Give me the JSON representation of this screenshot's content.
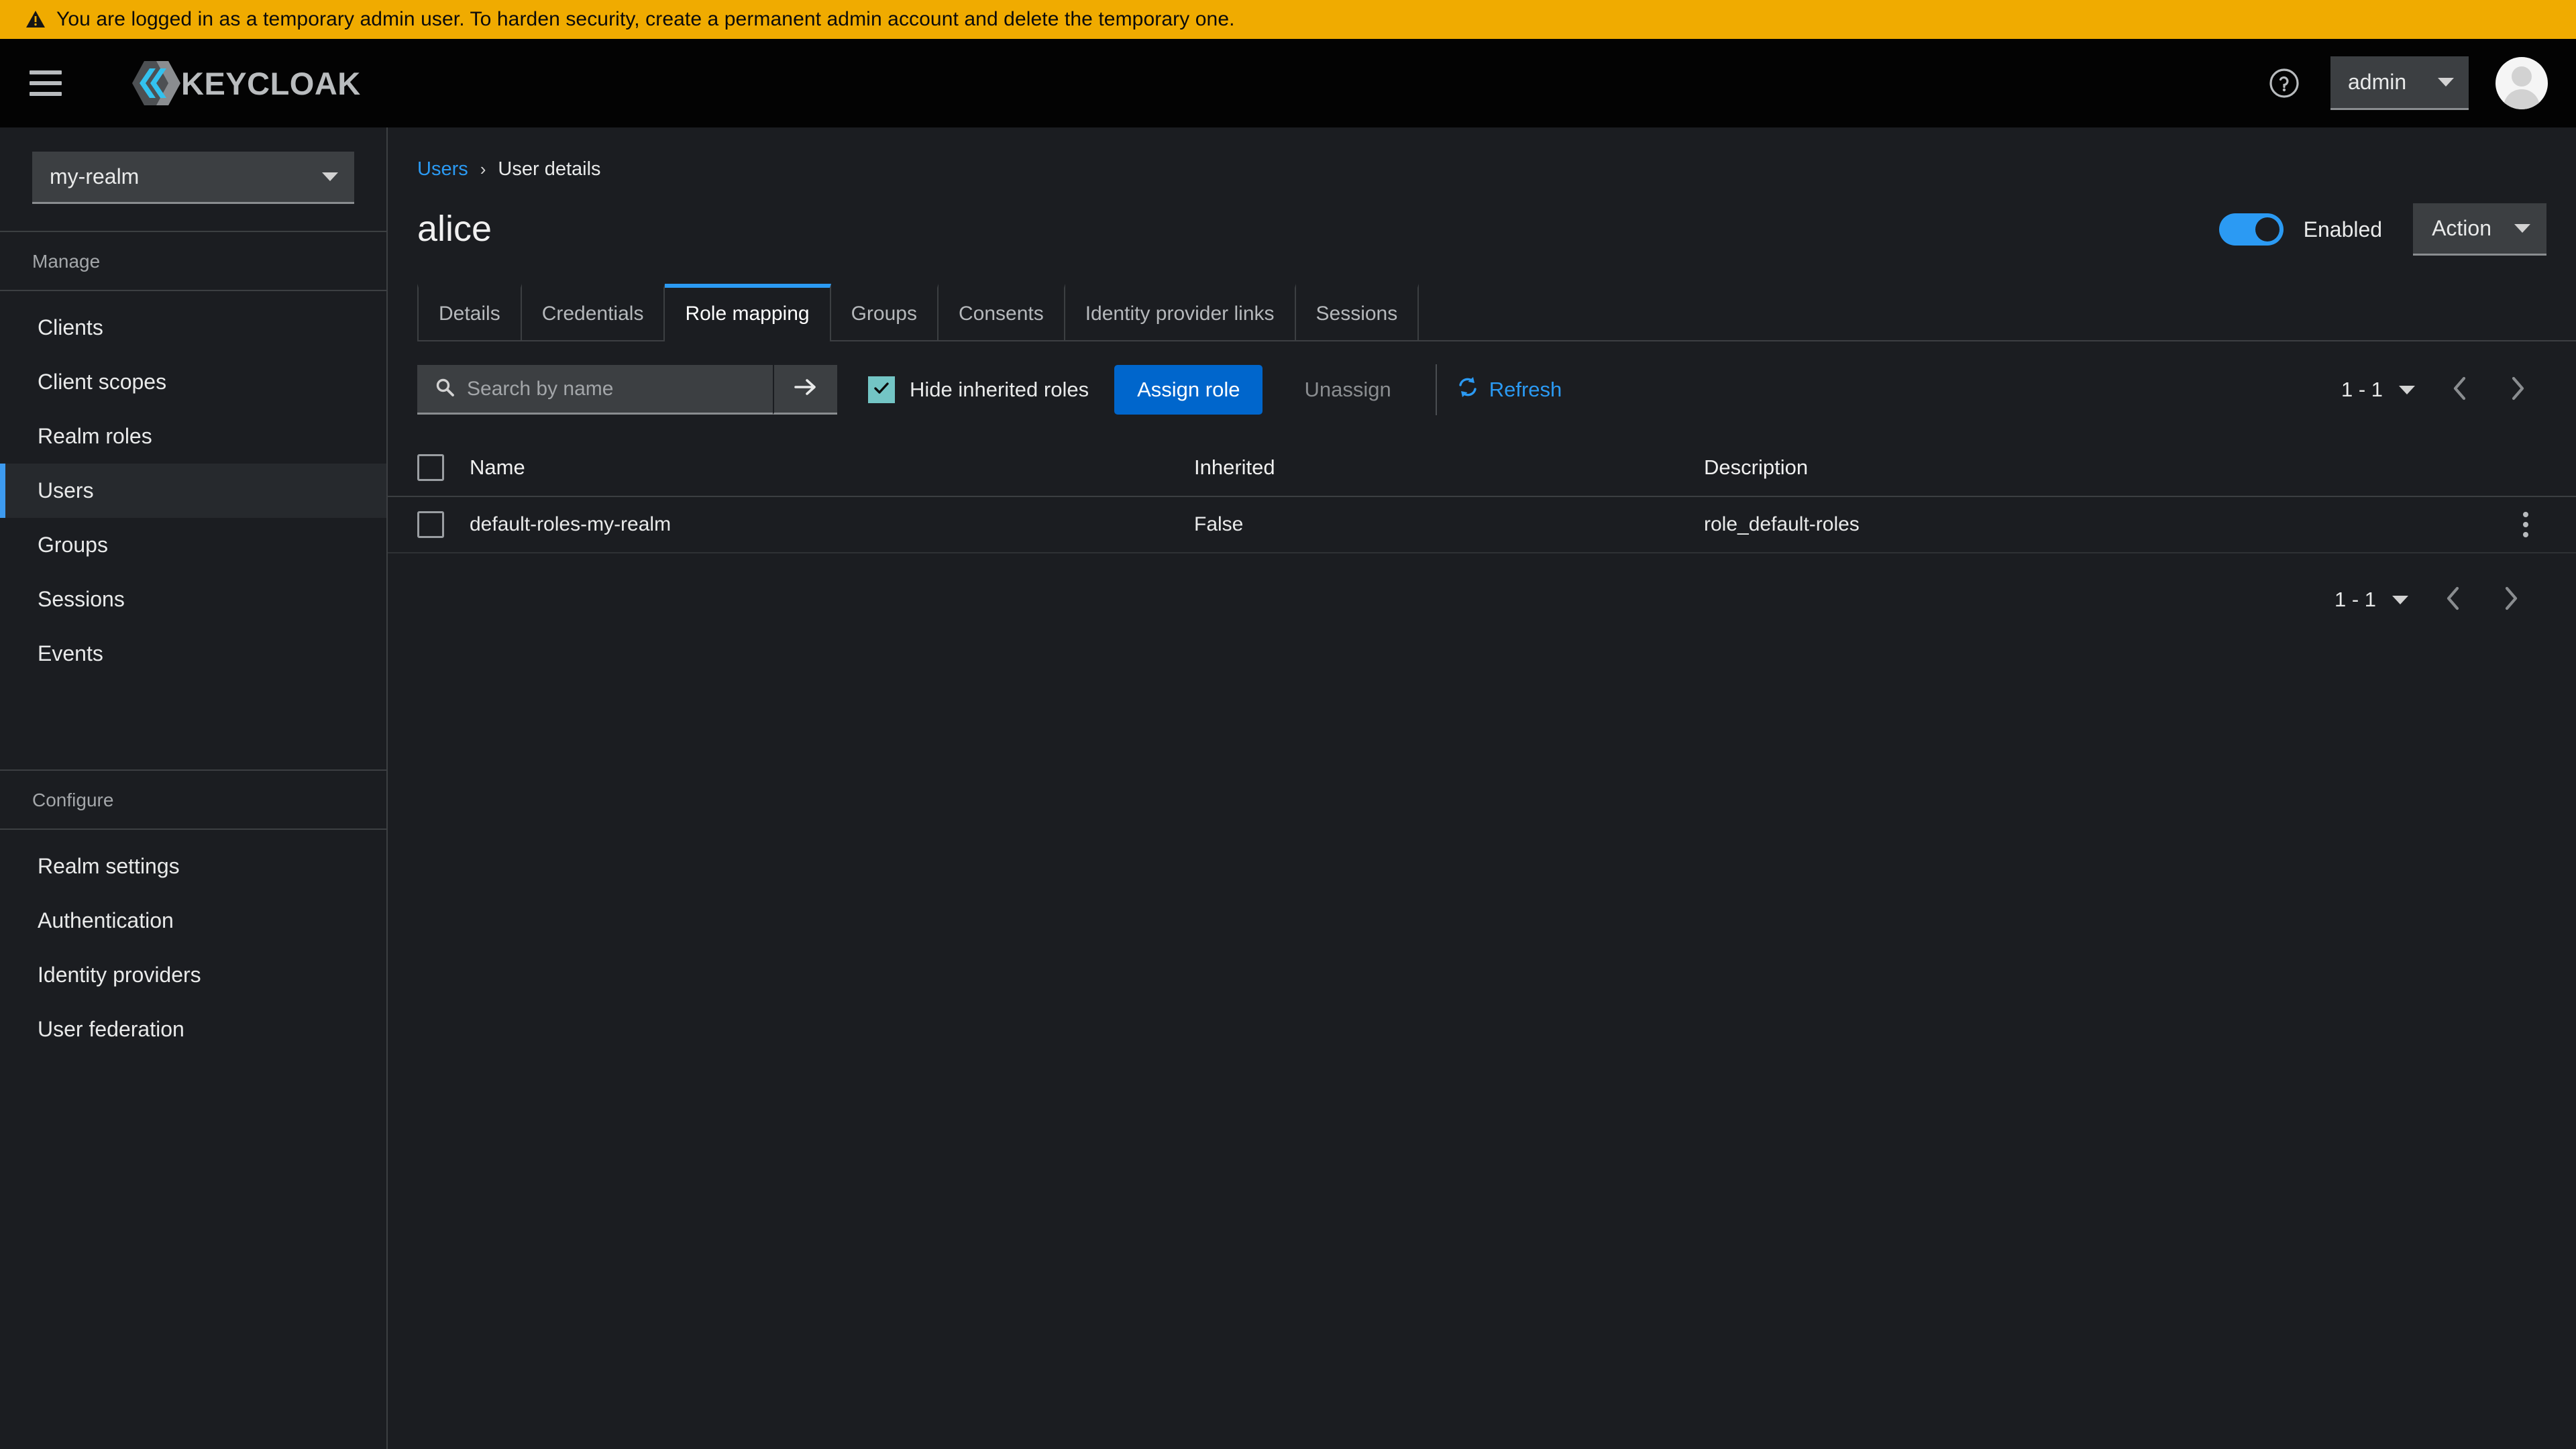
{
  "alert": {
    "icon": "warning-triangle-icon",
    "message": "You are logged in as a temporary admin user. To harden security, create a permanent admin account and delete the temporary one.",
    "background": "#f0ab00"
  },
  "masthead": {
    "menu_icon": "hamburger-icon",
    "brand_name": "KEYCLOAK",
    "help_icon": "help-circle-icon",
    "user_menu_label": "admin",
    "avatar_icon": "user-avatar-icon"
  },
  "sidebar": {
    "realm_selector": {
      "value": "my-realm",
      "caret_icon": "chevron-down-icon"
    },
    "sections": [
      {
        "title": "Manage",
        "items": [
          {
            "label": "Clients",
            "active": false
          },
          {
            "label": "Client scopes",
            "active": false
          },
          {
            "label": "Realm roles",
            "active": false
          },
          {
            "label": "Users",
            "active": true
          },
          {
            "label": "Groups",
            "active": false
          },
          {
            "label": "Sessions",
            "active": false
          },
          {
            "label": "Events",
            "active": false
          }
        ]
      },
      {
        "title": "Configure",
        "items": [
          {
            "label": "Realm settings",
            "active": false
          },
          {
            "label": "Authentication",
            "active": false
          },
          {
            "label": "Identity providers",
            "active": false
          },
          {
            "label": "User federation",
            "active": false
          }
        ]
      }
    ]
  },
  "breadcrumb": {
    "parent": "Users",
    "separator": "›",
    "current": "User details"
  },
  "page": {
    "title": "alice",
    "enabled_toggle": {
      "label": "Enabled",
      "state": "on",
      "color": "#2b9af3"
    },
    "action_menu": {
      "label": "Action",
      "caret_icon": "chevron-down-icon"
    }
  },
  "tabs": [
    {
      "label": "Details",
      "active": false
    },
    {
      "label": "Credentials",
      "active": false
    },
    {
      "label": "Role mapping",
      "active": true
    },
    {
      "label": "Groups",
      "active": false
    },
    {
      "label": "Consents",
      "active": false
    },
    {
      "label": "Identity provider links",
      "active": false
    },
    {
      "label": "Sessions",
      "active": false
    }
  ],
  "toolbar": {
    "search": {
      "icon": "search-icon",
      "placeholder": "Search by name",
      "value": "",
      "submit_icon": "arrow-right-icon"
    },
    "hide_inherited": {
      "label": "Hide inherited roles",
      "checked": true,
      "check_icon": "check-icon",
      "color": "#73c5c5"
    },
    "assign_role_label": "Assign role",
    "assign_role_color": "#0066cc",
    "unassign_label": "Unassign",
    "unassign_disabled": true,
    "refresh": {
      "label": "Refresh",
      "icon": "sync-icon",
      "color": "#2b9af3"
    }
  },
  "pagination_top": {
    "range": "1 - 1",
    "caret_icon": "chevron-down-icon",
    "prev_icon": "chevron-left-icon",
    "next_icon": "chevron-right-icon"
  },
  "pagination_bottom": {
    "range": "1 - 1",
    "caret_icon": "chevron-down-icon",
    "prev_icon": "chevron-left-icon",
    "next_icon": "chevron-right-icon"
  },
  "table": {
    "select_all_checkbox": "select-all-checkbox",
    "columns": [
      "Name",
      "Inherited",
      "Description"
    ],
    "rows": [
      {
        "name": "default-roles-my-realm",
        "inherited": "False",
        "description": "role_default-roles",
        "kebab_icon": "kebab-menu-icon"
      }
    ]
  }
}
